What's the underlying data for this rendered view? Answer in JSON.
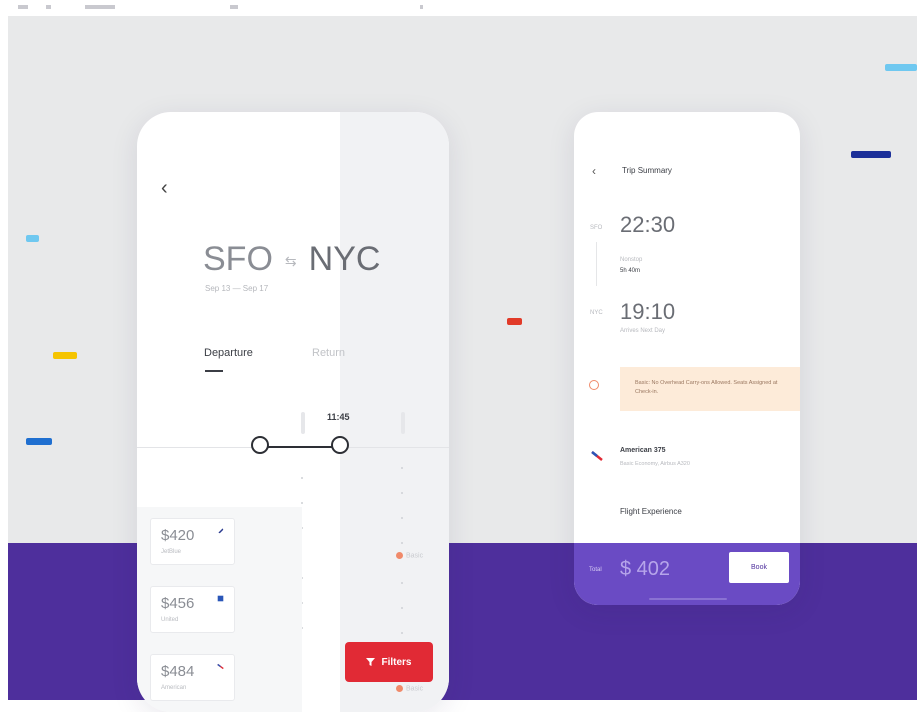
{
  "colors": {
    "background_grey": "#e8e9ea",
    "background_purple": "#4e2f9c",
    "accent_red": "#e12a35",
    "note_bg": "#fdebd9",
    "footer_purple": "#6a4bc4"
  },
  "search": {
    "origin": "SFO",
    "swap_icon": "swap-arrows-icon",
    "swap_glyph": "⇆",
    "destination": "NYC",
    "dates": "Sep 13 — Sep 17",
    "tabs": [
      {
        "label": "Departure",
        "active": true
      },
      {
        "label": "Return",
        "active": false
      }
    ],
    "time_selected": "11:45",
    "filters_label": "Filters"
  },
  "flights": [
    {
      "price": "$420",
      "airline": "JetBlue",
      "logo_color": "#2a3a8f"
    },
    {
      "price": "$456",
      "airline": "United",
      "logo_color": "#2a56b8"
    },
    {
      "price": "$484",
      "airline": "American",
      "logo_color": "#e12a35"
    }
  ],
  "badges": {
    "basic": "Basic"
  },
  "summary": {
    "back_icon": "chevron-left-icon",
    "title": "Trip Summary",
    "departure": {
      "code": "SFO",
      "time": "22:30",
      "duration_label": "Nonstop",
      "duration": "5h 40m"
    },
    "arrival": {
      "code": "NYC",
      "time": "19:10",
      "note": "Arrives Next Day"
    },
    "note": "Basic: No Overhead Carry-ons Allowed. Seats Assigned at Check-in.",
    "airline": "American 375",
    "airline_details": "Basic Economy, Airbus A320",
    "experience_label": "Flight Experience",
    "total_label": "Total",
    "total": "$ 402",
    "book_label": "Book"
  }
}
